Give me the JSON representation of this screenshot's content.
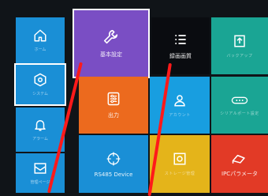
{
  "sidebar": {
    "items": [
      {
        "label": "ホーム",
        "icon": "home-icon"
      },
      {
        "label": "システム",
        "icon": "gear-icon"
      },
      {
        "label": "アラーム",
        "icon": "bell-icon"
      },
      {
        "label": "管理ページ",
        "icon": "inbox-icon"
      }
    ]
  },
  "grid": {
    "basic": {
      "label": "基本設定",
      "icon": "wrench-icon"
    },
    "record": {
      "label": "録画画質",
      "icon": "list-icon"
    },
    "backup": {
      "label": "バックアップ",
      "icon": "upload-box-icon"
    },
    "output": {
      "label": "出力",
      "icon": "sliders-icon"
    },
    "account": {
      "label": "アカウント",
      "icon": "user-icon"
    },
    "serial": {
      "label": "シリアルポート設定",
      "icon": "serial-port-icon"
    },
    "rs485": {
      "label": "RS485 Device",
      "icon": "crosshair-icon"
    },
    "storage": {
      "label": "ストレージ管理",
      "icon": "disk-icon"
    },
    "ipc": {
      "label": "IPCパラメータ",
      "icon": "camera-icon"
    }
  },
  "colors": {
    "background": "#101418",
    "sidebar_blue": "#1a8fd6",
    "purple": "#7a4ec4",
    "teal": "#1aa594",
    "orange": "#ec6a1e",
    "sky": "#189ee0",
    "red": "#e23a26",
    "yellow": "#e4b41a",
    "pointer": "#ff1a1a"
  }
}
